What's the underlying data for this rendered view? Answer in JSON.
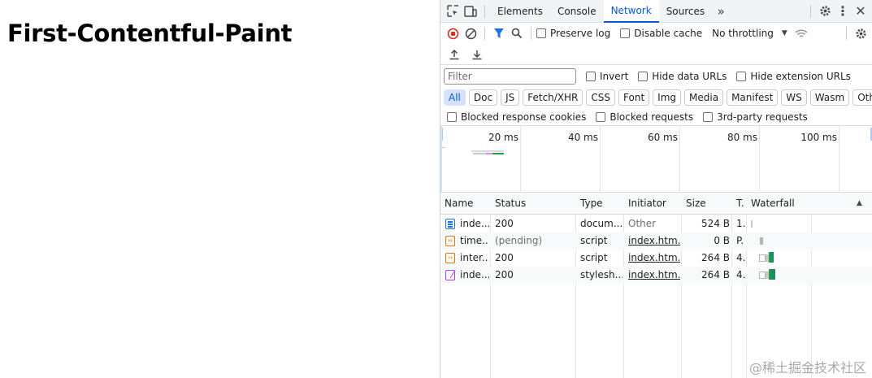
{
  "page": {
    "heading": "First-Contentful-Paint"
  },
  "tabs": [
    "Elements",
    "Console",
    "Network",
    "Sources"
  ],
  "active_tab": "Network",
  "toolbar": {
    "preserve_log": "Preserve log",
    "disable_cache": "Disable cache",
    "throttling": "No throttling"
  },
  "filter": {
    "placeholder": "Filter",
    "invert": "Invert",
    "hide_data_urls": "Hide data URLs",
    "hide_extension_urls": "Hide extension URLs"
  },
  "types": [
    "All",
    "Doc",
    "JS",
    "Fetch/XHR",
    "CSS",
    "Font",
    "Img",
    "Media",
    "Manifest",
    "WS",
    "Wasm",
    "Other"
  ],
  "blocked": {
    "response_cookies": "Blocked response cookies",
    "requests": "Blocked requests",
    "third_party": "3rd-party requests"
  },
  "timeline_ticks": [
    "20 ms",
    "40 ms",
    "60 ms",
    "80 ms",
    "100 ms"
  ],
  "columns": {
    "name": "Name",
    "status": "Status",
    "type": "Type",
    "initiator": "Initiator",
    "size": "Size",
    "time": "T.",
    "waterfall": "Waterfall"
  },
  "rows": [
    {
      "name": "inde...",
      "status": "200",
      "type": "docum...",
      "initiator": "Other",
      "size": "524 B",
      "time": "1.",
      "icon": "document-icon",
      "color": "#1a73e8"
    },
    {
      "name": "time...",
      "status": "(pending)",
      "type": "script",
      "initiator": "index.htm...",
      "size": "0 B",
      "time": "P.",
      "icon": "script-icon",
      "color": "#e8710a"
    },
    {
      "name": "inter...",
      "status": "200",
      "type": "script",
      "initiator": "index.htm...",
      "size": "264 B",
      "time": "4.",
      "icon": "script-icon",
      "color": "#e8710a"
    },
    {
      "name": "inde...",
      "status": "200",
      "type": "stylesh...",
      "initiator": "index.htm...",
      "size": "264 B",
      "time": "4.",
      "icon": "stylesheet-icon",
      "color": "#a142f4"
    }
  ],
  "watermark": "@稀土掘金技术社区"
}
